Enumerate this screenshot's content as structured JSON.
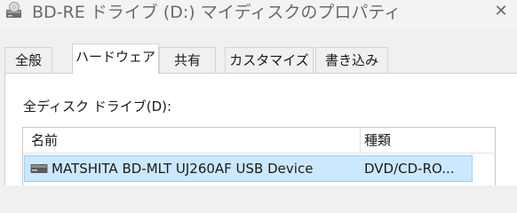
{
  "window": {
    "title": "BD-RE ドライブ (D:) マイディスクのプロパティ",
    "title_icon": "optical-drive-icon",
    "close_icon": "close-icon",
    "close_glyph": "✕"
  },
  "tabs": [
    {
      "label": "全般",
      "active": false
    },
    {
      "label": "ハードウェア",
      "active": true
    },
    {
      "label": "共有",
      "active": false
    },
    {
      "label": "カスタマイズ",
      "active": false
    },
    {
      "label": "書き込み",
      "active": false
    }
  ],
  "hardware": {
    "drives_label": "全ディスク ドライブ(D):",
    "columns": {
      "name": "名前",
      "type": "種類"
    },
    "devices": [
      {
        "icon": "drive-icon",
        "name": "MATSHITA BD-MLT UJ260AF USB Device",
        "type": "DVD/CD-RO...",
        "selected": true
      }
    ]
  },
  "colors": {
    "selection_bg": "#cce8ff",
    "selection_border": "#99d1ff",
    "title_text": "#6a6a6a"
  }
}
